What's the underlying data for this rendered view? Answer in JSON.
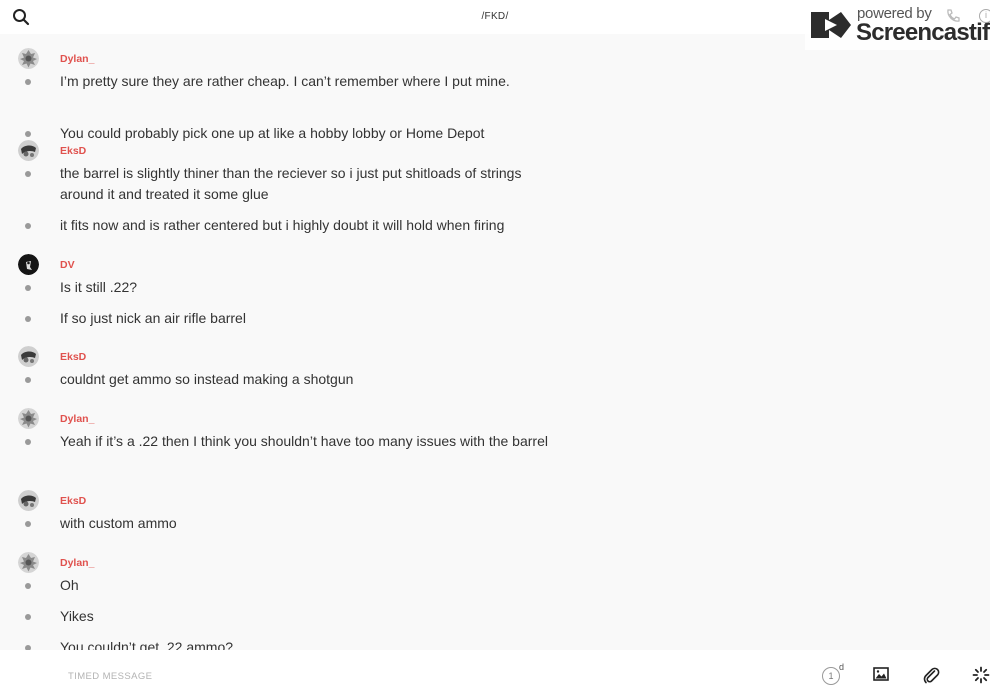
{
  "header": {
    "title": "/FKD/"
  },
  "watermark": {
    "powered": "powered by",
    "brand": "Screencastify"
  },
  "messages": [
    {
      "user": "Dylan_",
      "avatar": "gray-emblem-avatar",
      "lines": [
        "I’m pretty sure they are rather cheap. I can’t remember where I put mine.",
        "You could probably pick one up at like a hobby lobby or Home Depot"
      ]
    },
    {
      "user": "EksD",
      "avatar": "sketch-avatar",
      "lines": [
        "the barrel is slightly thiner than the reciever so i just put shitloads of strings around it and treated it some glue",
        "it fits now and is rather centered but i highly doubt it will hold when firing"
      ]
    },
    {
      "user": "DV",
      "avatar": "dark-avatar",
      "lines": [
        "Is it still .22?",
        "If so just nick an air rifle barrel"
      ]
    },
    {
      "user": "EksD",
      "avatar": "sketch-avatar",
      "lines": [
        "couldnt get ammo so instead making a shotgun"
      ]
    },
    {
      "user": "Dylan_",
      "avatar": "gray-emblem-avatar",
      "lines": [
        "Yeah if it’s a .22 then I think you shouldn’t have too many issues with the barrel"
      ]
    },
    {
      "user": "EksD",
      "avatar": "sketch-avatar",
      "lines": [
        "with custom ammo"
      ]
    },
    {
      "user": "Dylan_",
      "avatar": "gray-emblem-avatar",
      "lines": [
        "Oh",
        "Yikes",
        "You couldn’t get .22 ammo?"
      ]
    }
  ],
  "composer": {
    "placeholder": "TIMED MESSAGE",
    "timer_value": "1",
    "timer_unit": "d"
  },
  "colors": {
    "username": "#e0524e",
    "background": "#f9f9f9"
  }
}
